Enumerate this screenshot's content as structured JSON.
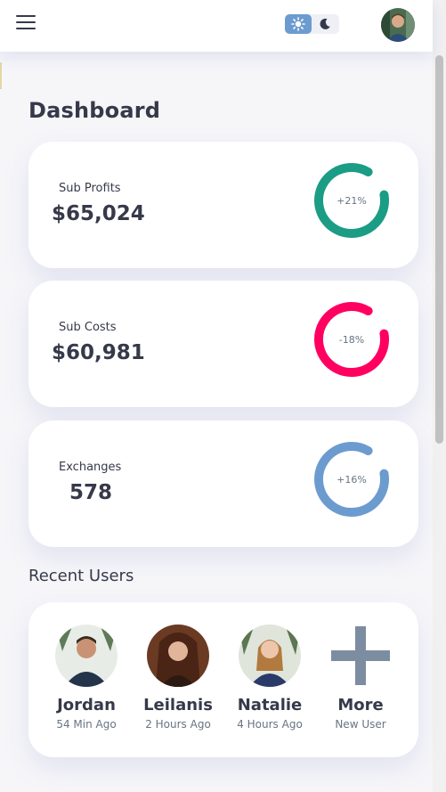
{
  "header": {
    "theme_options": [
      "light",
      "dark"
    ],
    "active_theme": "light"
  },
  "page": {
    "title": "Dashboard"
  },
  "stats": [
    {
      "label": "Sub Profits",
      "value": "$65,024",
      "percent_text": "+21%",
      "ring_color": "#1b9c85"
    },
    {
      "label": "Sub Costs",
      "value": "$60,981",
      "percent_text": "-18%",
      "ring_color": "#ff0060"
    },
    {
      "label": "Exchanges",
      "value": "578",
      "percent_text": "+16%",
      "ring_color": "#6c9bcf"
    }
  ],
  "recent_users": {
    "title": "Recent Users",
    "users": [
      {
        "name": "Jordan",
        "time": "54 Min Ago"
      },
      {
        "name": "Leilanis",
        "time": "2 Hours Ago"
      },
      {
        "name": "Natalie",
        "time": "4 Hours Ago"
      }
    ],
    "more": {
      "name": "More",
      "time": "New User",
      "color": "#7d8da1"
    }
  },
  "colors": {
    "background": "#f6f6f9",
    "text": "#363949",
    "muted": "#677483",
    "accent": "#6c9bcf"
  }
}
